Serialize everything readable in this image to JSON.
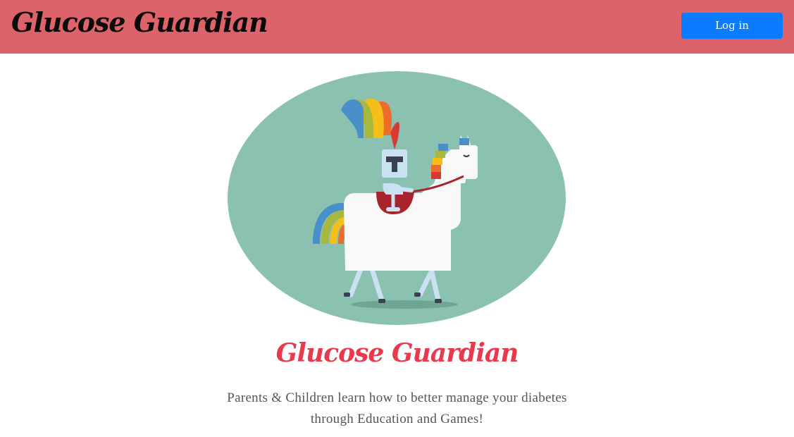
{
  "navbar": {
    "brand": "Glucose Guardian",
    "login_label": "Log in"
  },
  "hero": {
    "image_icon": "unicorn-knight-illustration",
    "title": "Glucose Guardian",
    "tagline_line1": "Parents & Children learn how to better manage your diabetes",
    "tagline_line2": "through Education and Games!"
  },
  "colors": {
    "navbar_bg": "#dc636a",
    "login_button_bg": "#0b7bff",
    "hero_title": "#e83a4c",
    "illustration_bg": "#8bc1b0"
  }
}
